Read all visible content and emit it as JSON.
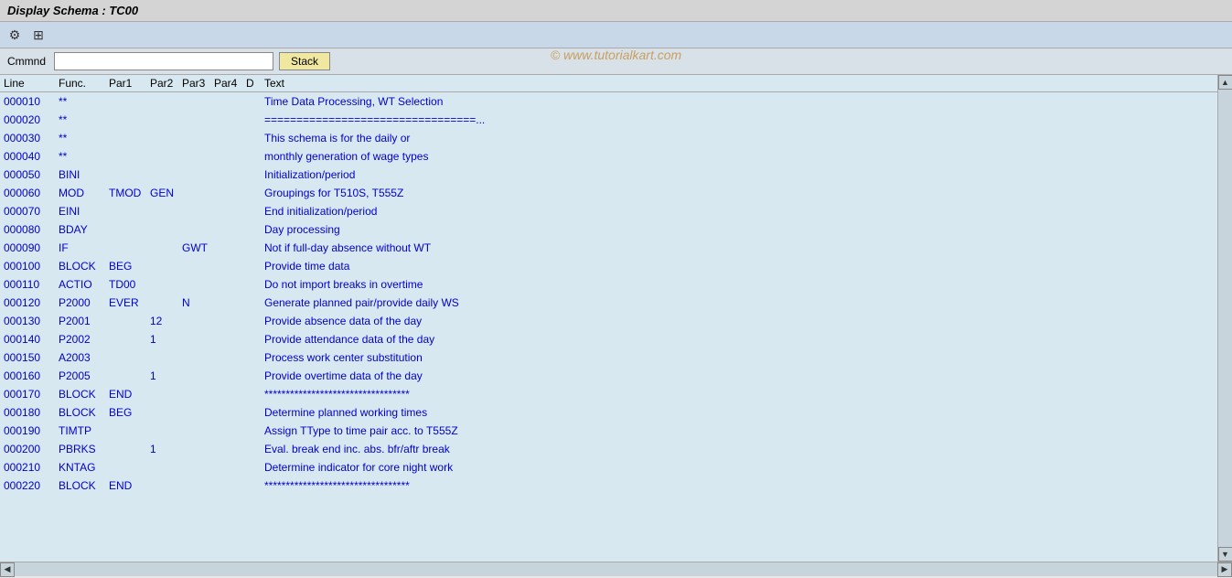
{
  "titleBar": {
    "text": "Display Schema : TC00"
  },
  "toolbar": {
    "icons": [
      {
        "name": "config-icon",
        "symbol": "⚙"
      },
      {
        "name": "layout-icon",
        "symbol": "⊞"
      }
    ]
  },
  "watermark": {
    "text": "© www.tutorialkart.com"
  },
  "commandBar": {
    "label": "Cmmnd",
    "inputValue": "",
    "inputPlaceholder": "",
    "stackButton": "Stack"
  },
  "tableHeader": {
    "line": "Line",
    "func": "Func.",
    "par1": "Par1",
    "par2": "Par2",
    "par3": "Par3",
    "par4": "Par4",
    "d": "D",
    "text": "Text"
  },
  "rows": [
    {
      "line": "000010",
      "func": "**",
      "par1": "",
      "par2": "",
      "par3": "",
      "par4": "",
      "d": "",
      "text": "Time Data Processing, WT Selection"
    },
    {
      "line": "000020",
      "func": "**",
      "par1": "",
      "par2": "",
      "par3": "",
      "par4": "",
      "d": "",
      "text": "=================================..."
    },
    {
      "line": "000030",
      "func": "**",
      "par1": "",
      "par2": "",
      "par3": "",
      "par4": "",
      "d": "",
      "text": "This schema is for the daily or"
    },
    {
      "line": "000040",
      "func": "**",
      "par1": "",
      "par2": "",
      "par3": "",
      "par4": "",
      "d": "",
      "text": "monthly generation of wage types"
    },
    {
      "line": "000050",
      "func": "BINI",
      "par1": "",
      "par2": "",
      "par3": "",
      "par4": "",
      "d": "",
      "text": "Initialization/period"
    },
    {
      "line": "000060",
      "func": "MOD",
      "par1": "TMOD",
      "par2": "GEN",
      "par3": "",
      "par4": "",
      "d": "",
      "text": "Groupings for T510S, T555Z"
    },
    {
      "line": "000070",
      "func": "EINI",
      "par1": "",
      "par2": "",
      "par3": "",
      "par4": "",
      "d": "",
      "text": "End initialization/period"
    },
    {
      "line": "000080",
      "func": "BDAY",
      "par1": "",
      "par2": "",
      "par3": "",
      "par4": "",
      "d": "",
      "text": "Day processing"
    },
    {
      "line": "000090",
      "func": "IF",
      "par1": "",
      "par2": "",
      "par3": "GWT",
      "par4": "",
      "d": "",
      "text": "Not if full-day absence without WT"
    },
    {
      "line": "000100",
      "func": "BLOCK",
      "par1": "BEG",
      "par2": "",
      "par3": "",
      "par4": "",
      "d": "",
      "text": "Provide time data"
    },
    {
      "line": "000110",
      "func": "ACTIO",
      "par1": "TD00",
      "par2": "",
      "par3": "",
      "par4": "",
      "d": "",
      "text": "Do not import breaks in overtime"
    },
    {
      "line": "000120",
      "func": "P2000",
      "par1": "EVER",
      "par2": "",
      "par3": "N",
      "par4": "",
      "d": "",
      "text": "Generate planned pair/provide daily WS"
    },
    {
      "line": "000130",
      "func": "P2001",
      "par1": "",
      "par2": "12",
      "par3": "",
      "par4": "",
      "d": "",
      "text": "Provide absence data of the day"
    },
    {
      "line": "000140",
      "func": "P2002",
      "par1": "",
      "par2": "1",
      "par3": "",
      "par4": "",
      "d": "",
      "text": "Provide attendance data of the day"
    },
    {
      "line": "000150",
      "func": "A2003",
      "par1": "",
      "par2": "",
      "par3": "",
      "par4": "",
      "d": "",
      "text": "Process work center substitution"
    },
    {
      "line": "000160",
      "func": "P2005",
      "par1": "",
      "par2": "1",
      "par3": "",
      "par4": "",
      "d": "",
      "text": "Provide overtime data of the day"
    },
    {
      "line": "000170",
      "func": "BLOCK",
      "par1": "END",
      "par2": "",
      "par3": "",
      "par4": "",
      "d": "",
      "text": "**********************************"
    },
    {
      "line": "000180",
      "func": "BLOCK",
      "par1": "BEG",
      "par2": "",
      "par3": "",
      "par4": "",
      "d": "",
      "text": "Determine planned working times"
    },
    {
      "line": "000190",
      "func": "TIMTP",
      "par1": "",
      "par2": "",
      "par3": "",
      "par4": "",
      "d": "",
      "text": "Assign TType to time pair acc. to T555Z"
    },
    {
      "line": "000200",
      "func": "PBRKS",
      "par1": "",
      "par2": "1",
      "par3": "",
      "par4": "",
      "d": "",
      "text": "Eval. break end inc. abs. bfr/aftr break"
    },
    {
      "line": "000210",
      "func": "KNTAG",
      "par1": "",
      "par2": "",
      "par3": "",
      "par4": "",
      "d": "",
      "text": "Determine indicator for core night work"
    },
    {
      "line": "000220",
      "func": "BLOCK",
      "par1": "END",
      "par2": "",
      "par3": "",
      "par4": "",
      "d": "",
      "text": "**********************************"
    }
  ]
}
